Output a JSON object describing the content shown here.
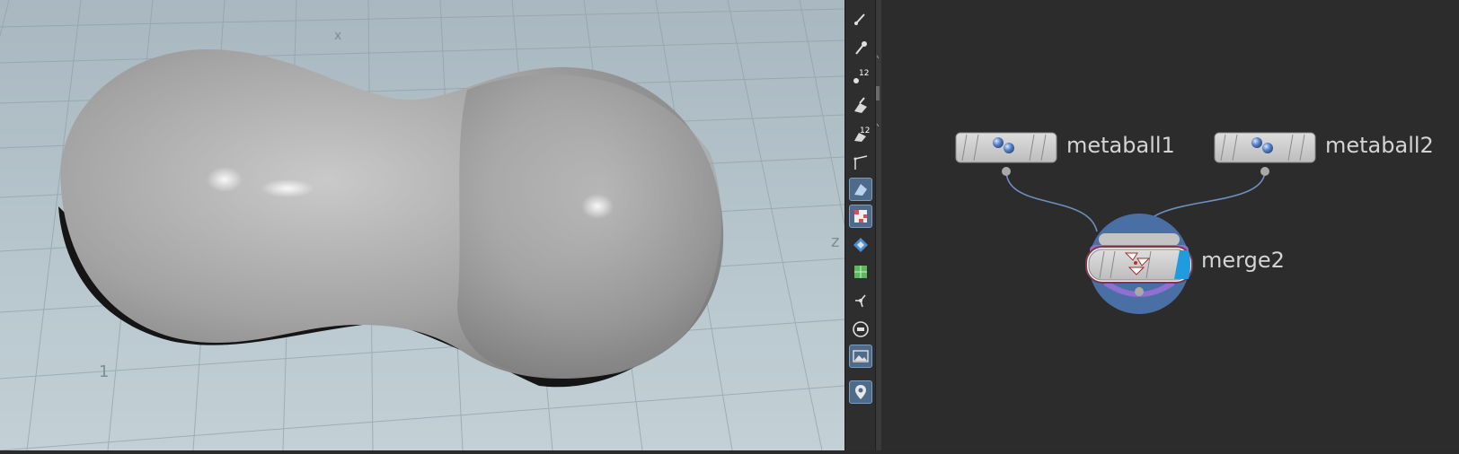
{
  "viewport": {
    "axis_labels": {
      "x": "1",
      "z": "z",
      "top": "x"
    }
  },
  "toolbar": {
    "tools": [
      {
        "name": "select-tool-icon",
        "active": false
      },
      {
        "name": "pose-tool-icon",
        "active": false
      },
      {
        "name": "point-number-icon",
        "badge": "12",
        "active": false
      },
      {
        "name": "primitive-tool-icon",
        "active": false
      },
      {
        "name": "primitive-number-icon",
        "badge": "12",
        "active": false
      },
      {
        "name": "edge-tool-icon",
        "active": false
      },
      {
        "name": "shading-tool-icon",
        "active": true
      },
      {
        "name": "texture-checker-icon",
        "active": true
      },
      {
        "name": "snapping-icon",
        "active": false
      },
      {
        "name": "uv-grid-icon",
        "active": false
      },
      {
        "name": "handle-tool-icon",
        "active": false
      },
      {
        "name": "circle-tool-icon",
        "active": false
      },
      {
        "name": "background-image-icon",
        "active": true
      },
      {
        "name": "location-pin-icon",
        "active": true
      }
    ]
  },
  "network": {
    "nodes": [
      {
        "id": "metaball1",
        "label": "metaball1"
      },
      {
        "id": "metaball2",
        "label": "metaball2"
      },
      {
        "id": "merge2",
        "label": "merge2"
      }
    ],
    "colors": {
      "node_body": "#cfcfcf",
      "wire": "#6f8fc0",
      "selection_ring": "#4a6fa5",
      "merge_purple": "#8f6fd0",
      "display_flag": "#1f9be0",
      "text": "#d4d4d4"
    }
  }
}
